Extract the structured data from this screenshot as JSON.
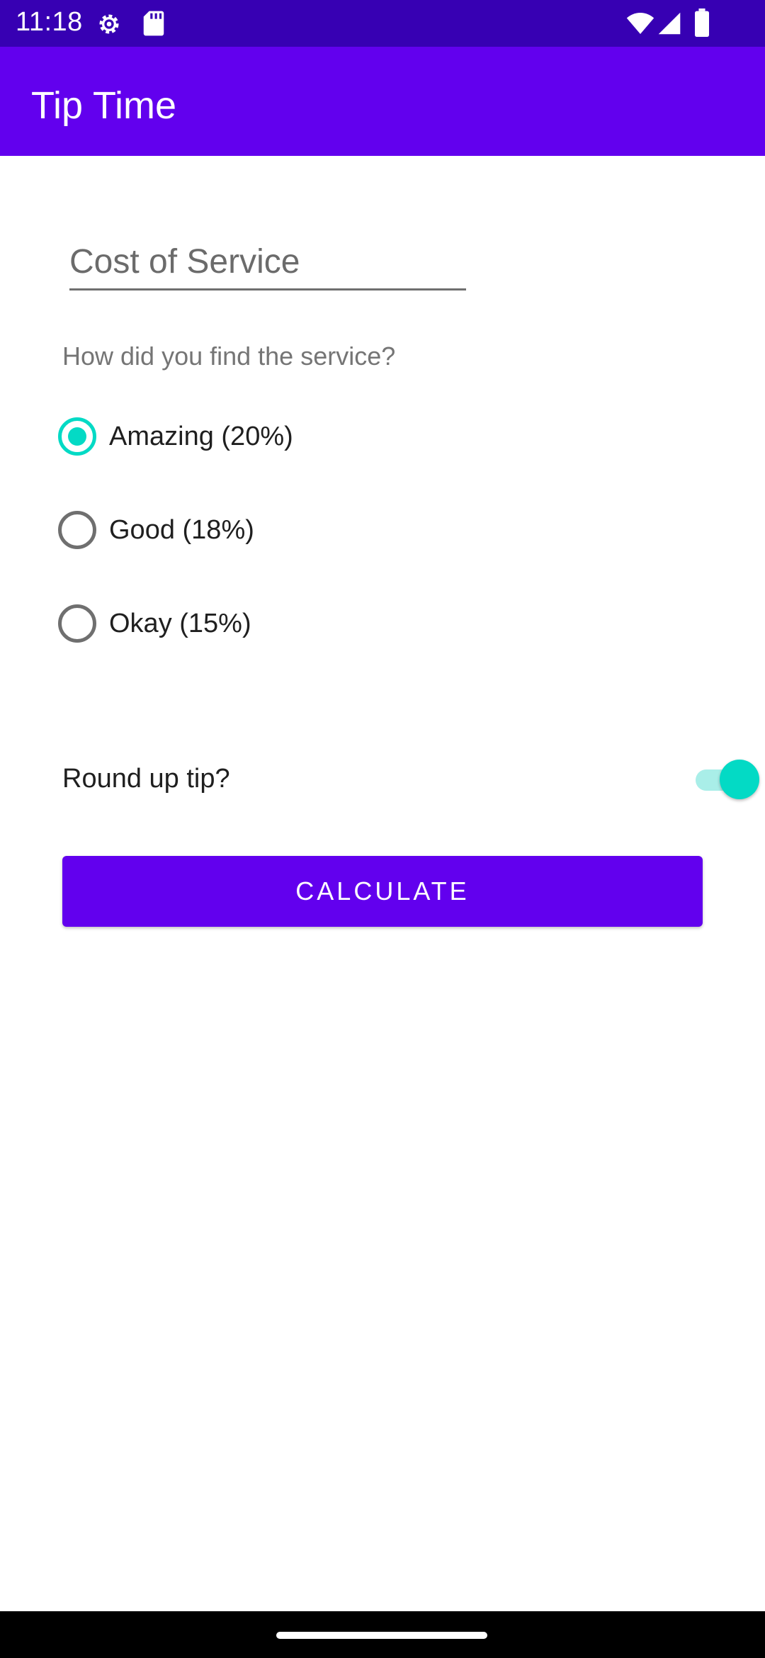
{
  "status_bar": {
    "time": "11:18",
    "icons": [
      "settings-gear-icon",
      "sd-card-icon",
      "wifi-icon",
      "signal-icon",
      "battery-icon"
    ]
  },
  "app_bar": {
    "title": "Tip Time"
  },
  "form": {
    "cost_placeholder": "Cost of Service",
    "question": "How did you find the service?",
    "options": [
      {
        "label": "Amazing (20%)",
        "checked": true
      },
      {
        "label": "Good (18%)",
        "checked": false
      },
      {
        "label": "Okay (15%)",
        "checked": false
      }
    ],
    "round_up_label": "Round up tip?",
    "round_up_on": true,
    "calculate_label": "CALCULATE"
  },
  "colors": {
    "primary": "#6200ee",
    "primary_dark": "#3700b3",
    "accent": "#03dac5"
  }
}
